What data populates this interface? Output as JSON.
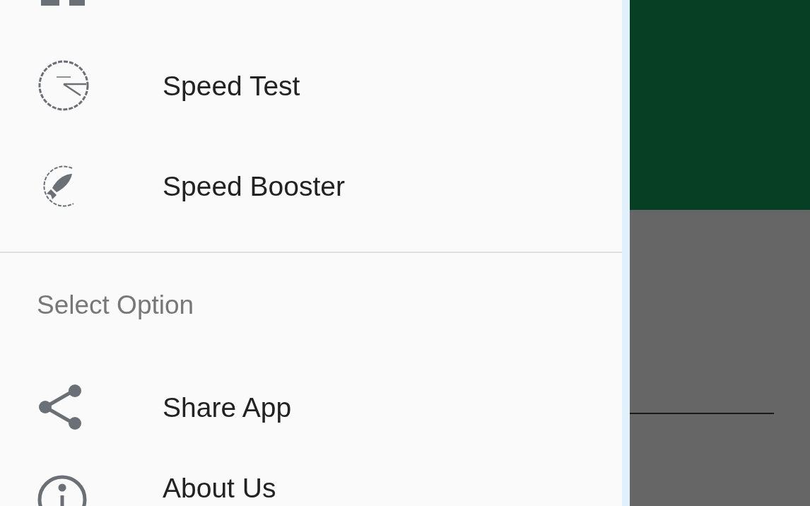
{
  "drawer": {
    "sections": [
      {
        "items": [
          {
            "kind": "grid"
          },
          {
            "kind": "speedometer",
            "label": "Speed Test"
          },
          {
            "kind": "rocket",
            "label": "Speed Booster"
          }
        ]
      },
      {
        "header": "Select Option",
        "items": [
          {
            "kind": "share",
            "label": "Share App"
          },
          {
            "kind": "info",
            "label": "About Us"
          }
        ]
      }
    ]
  }
}
